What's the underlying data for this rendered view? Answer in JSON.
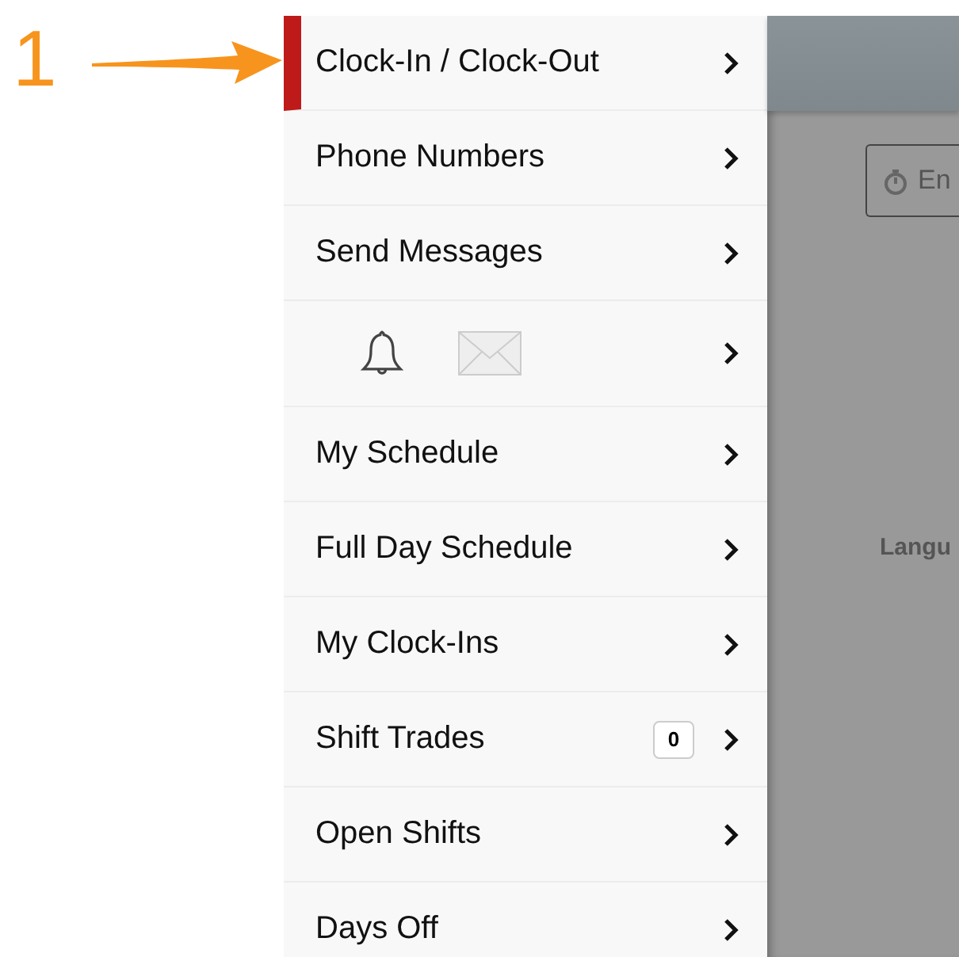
{
  "annotation": {
    "number": "1"
  },
  "menu": {
    "items": [
      {
        "kind": "text",
        "label": "Clock-In / Clock-Out",
        "selected": true
      },
      {
        "kind": "text",
        "label": "Phone Numbers",
        "selected": false
      },
      {
        "kind": "text",
        "label": "Send Messages",
        "selected": false
      },
      {
        "kind": "icons",
        "selected": false
      },
      {
        "kind": "text",
        "label": "My Schedule",
        "selected": false
      },
      {
        "kind": "text",
        "label": "Full Day Schedule",
        "selected": false
      },
      {
        "kind": "text",
        "label": "My Clock-Ins",
        "selected": false
      },
      {
        "kind": "text",
        "label": "Shift Trades",
        "badge": "0",
        "selected": false
      },
      {
        "kind": "text",
        "label": "Open Shifts",
        "selected": false
      },
      {
        "kind": "text",
        "label": "Days Off",
        "selected": false
      }
    ]
  },
  "background": {
    "button": {
      "label": "En"
    },
    "field_label": "Langu"
  }
}
